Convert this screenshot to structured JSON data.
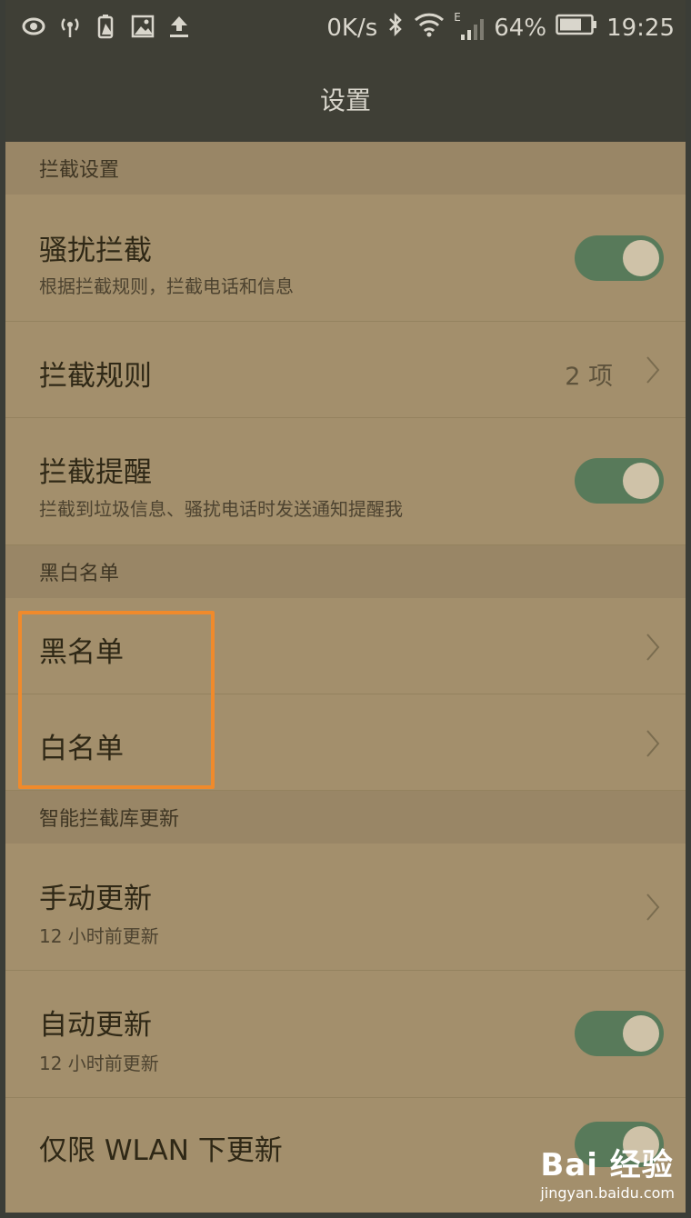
{
  "status_bar": {
    "speed": "0K/s",
    "network": "E",
    "battery": "64%",
    "time": "19:25",
    "icons": [
      "eye-icon",
      "hotspot-icon",
      "battery-warning-icon",
      "image-icon",
      "upload-icon",
      "bluetooth-icon",
      "wifi-icon",
      "signal-icon",
      "battery-icon"
    ]
  },
  "app_bar": {
    "title": "设置"
  },
  "sections": {
    "intercept_settings": "拦截设置",
    "black_white_list": "黑白名单",
    "smart_library_update": "智能拦截库更新"
  },
  "rows": {
    "harassment_block": {
      "title": "骚扰拦截",
      "subtitle": "根据拦截规则，拦截电话和信息",
      "toggle": "on"
    },
    "block_rules": {
      "title": "拦截规则",
      "value": "2 项"
    },
    "block_reminder": {
      "title": "拦截提醒",
      "subtitle": "拦截到垃圾信息、骚扰电话时发送通知提醒我",
      "toggle": "on"
    },
    "blacklist": {
      "title": "黑名单"
    },
    "whitelist": {
      "title": "白名单"
    },
    "manual_update": {
      "title": "手动更新",
      "subtitle": "12 小时前更新"
    },
    "auto_update": {
      "title": "自动更新",
      "subtitle": "12 小时前更新",
      "toggle": "on"
    },
    "wlan_only": {
      "title": "仅限 WLAN 下更新",
      "toggle": "on"
    }
  },
  "colors": {
    "background": "#a38f6c",
    "section_header": "#998666",
    "toggle_on": "#587a5a",
    "highlight_box": "#f08a2b"
  },
  "watermark": {
    "main": "Bai 经验",
    "sub": "jingyan.baidu.com"
  }
}
